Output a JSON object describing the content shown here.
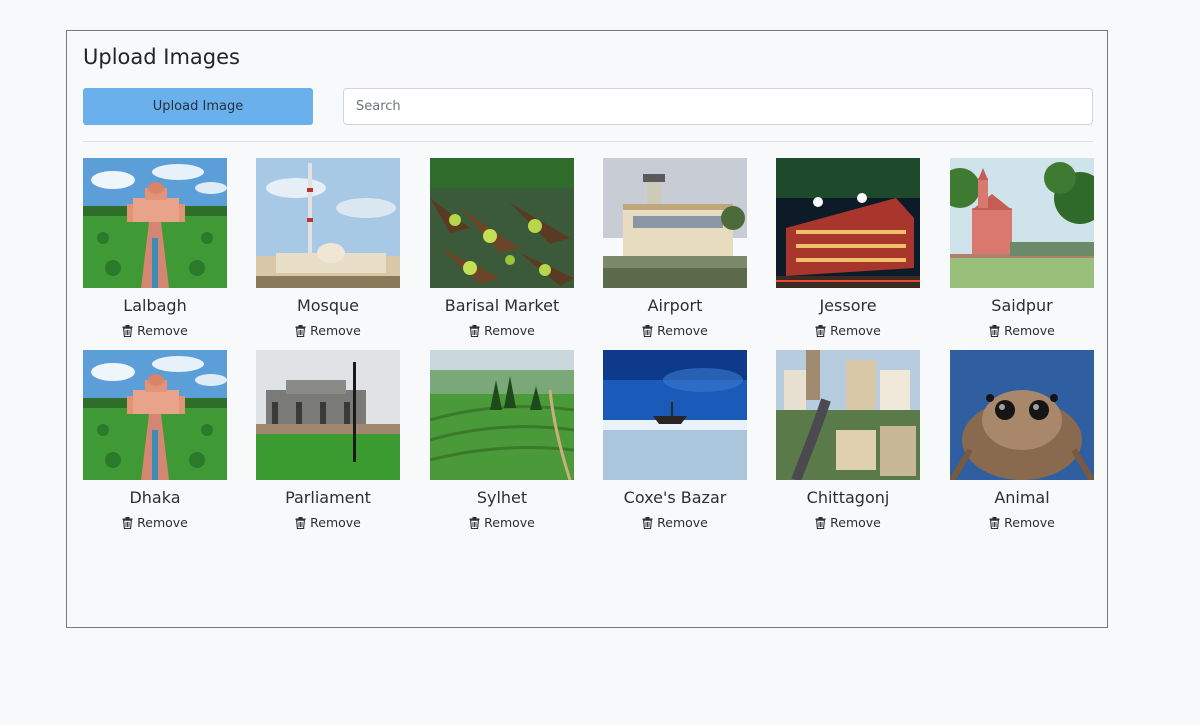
{
  "page": {
    "title": "Upload Images",
    "upload_label": "Upload Image",
    "search_placeholder": "Search",
    "search_value": ""
  },
  "gallery": [
    {
      "name": "Lalbagh",
      "remove_label": "Remove",
      "scene": "fort-garden"
    },
    {
      "name": "Mosque",
      "remove_label": "Remove",
      "scene": "mosque"
    },
    {
      "name": "Barisal Market",
      "remove_label": "Remove",
      "scene": "boat-market"
    },
    {
      "name": "Airport",
      "remove_label": "Remove",
      "scene": "airport"
    },
    {
      "name": "Jessore",
      "remove_label": "Remove",
      "scene": "night-building"
    },
    {
      "name": "Saidpur",
      "remove_label": "Remove",
      "scene": "church"
    },
    {
      "name": "Dhaka",
      "remove_label": "Remove",
      "scene": "fort-garden"
    },
    {
      "name": "Parliament",
      "remove_label": "Remove",
      "scene": "parliament"
    },
    {
      "name": "Sylhet",
      "remove_label": "Remove",
      "scene": "tea-garden"
    },
    {
      "name": "Coxe's Bazar",
      "remove_label": "Remove",
      "scene": "beach"
    },
    {
      "name": "Chittagonj",
      "remove_label": "Remove",
      "scene": "city"
    },
    {
      "name": "Animal",
      "remove_label": "Remove",
      "scene": "spider"
    }
  ],
  "colors": {
    "upload_button": "#6ab0ec",
    "panel_border": "#7a7a7a",
    "background": "#f8f9fb"
  }
}
